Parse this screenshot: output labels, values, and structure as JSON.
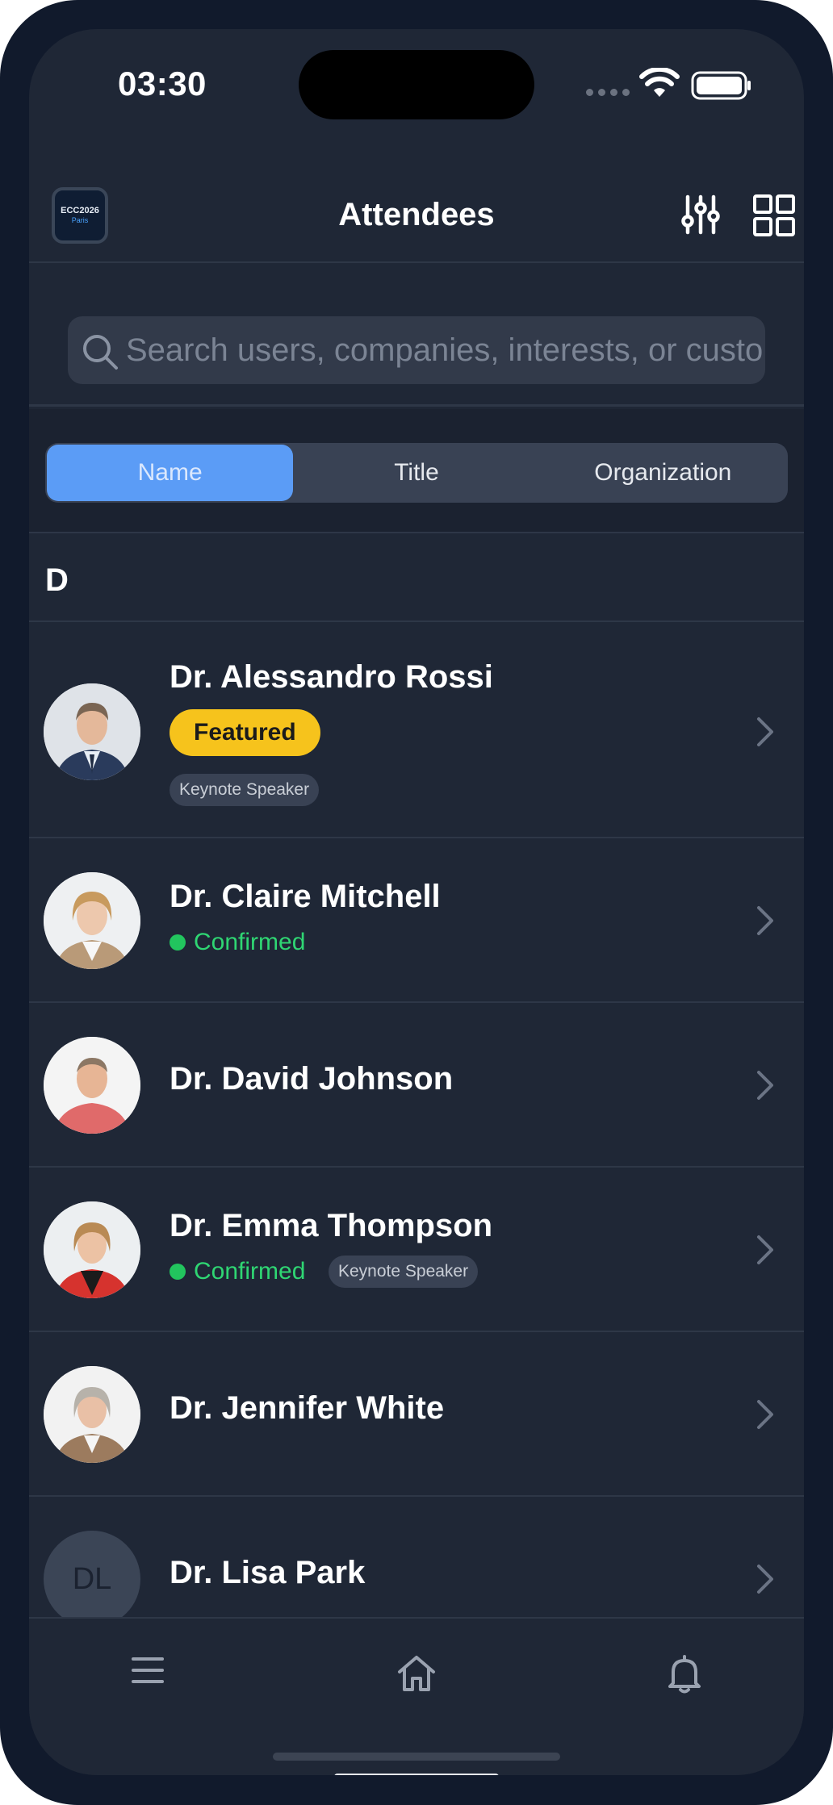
{
  "status": {
    "time": "03:30"
  },
  "header": {
    "logo_line1": "ECC2026",
    "logo_line2": "Paris",
    "title": "Attendees"
  },
  "search": {
    "placeholder": "Search users, companies, interests, or custom fields...",
    "value": ""
  },
  "segments": [
    {
      "label": "Name",
      "active": true
    },
    {
      "label": "Title",
      "active": false
    },
    {
      "label": "Organization",
      "active": false
    }
  ],
  "section": {
    "letter": "D"
  },
  "attendees": [
    {
      "name": "Dr. Alessandro Rossi",
      "featured": "Featured",
      "tag": "Keynote Speaker"
    },
    {
      "name": "Dr. Claire Mitchell",
      "status": "Confirmed"
    },
    {
      "name": "Dr. David Johnson"
    },
    {
      "name": "Dr. Emma Thompson",
      "status": "Confirmed",
      "tag": "Keynote Speaker"
    },
    {
      "name": "Dr. Jennifer White"
    },
    {
      "name": "Dr. Lisa Park",
      "initials": "DL"
    }
  ],
  "tabbar": {
    "icons": [
      "menu-icon",
      "home-icon",
      "bell-icon"
    ]
  },
  "colors": {
    "accent": "#5b9cf6",
    "featured": "#f6c31c",
    "confirmed": "#22c55e",
    "background": "#1f2736"
  }
}
